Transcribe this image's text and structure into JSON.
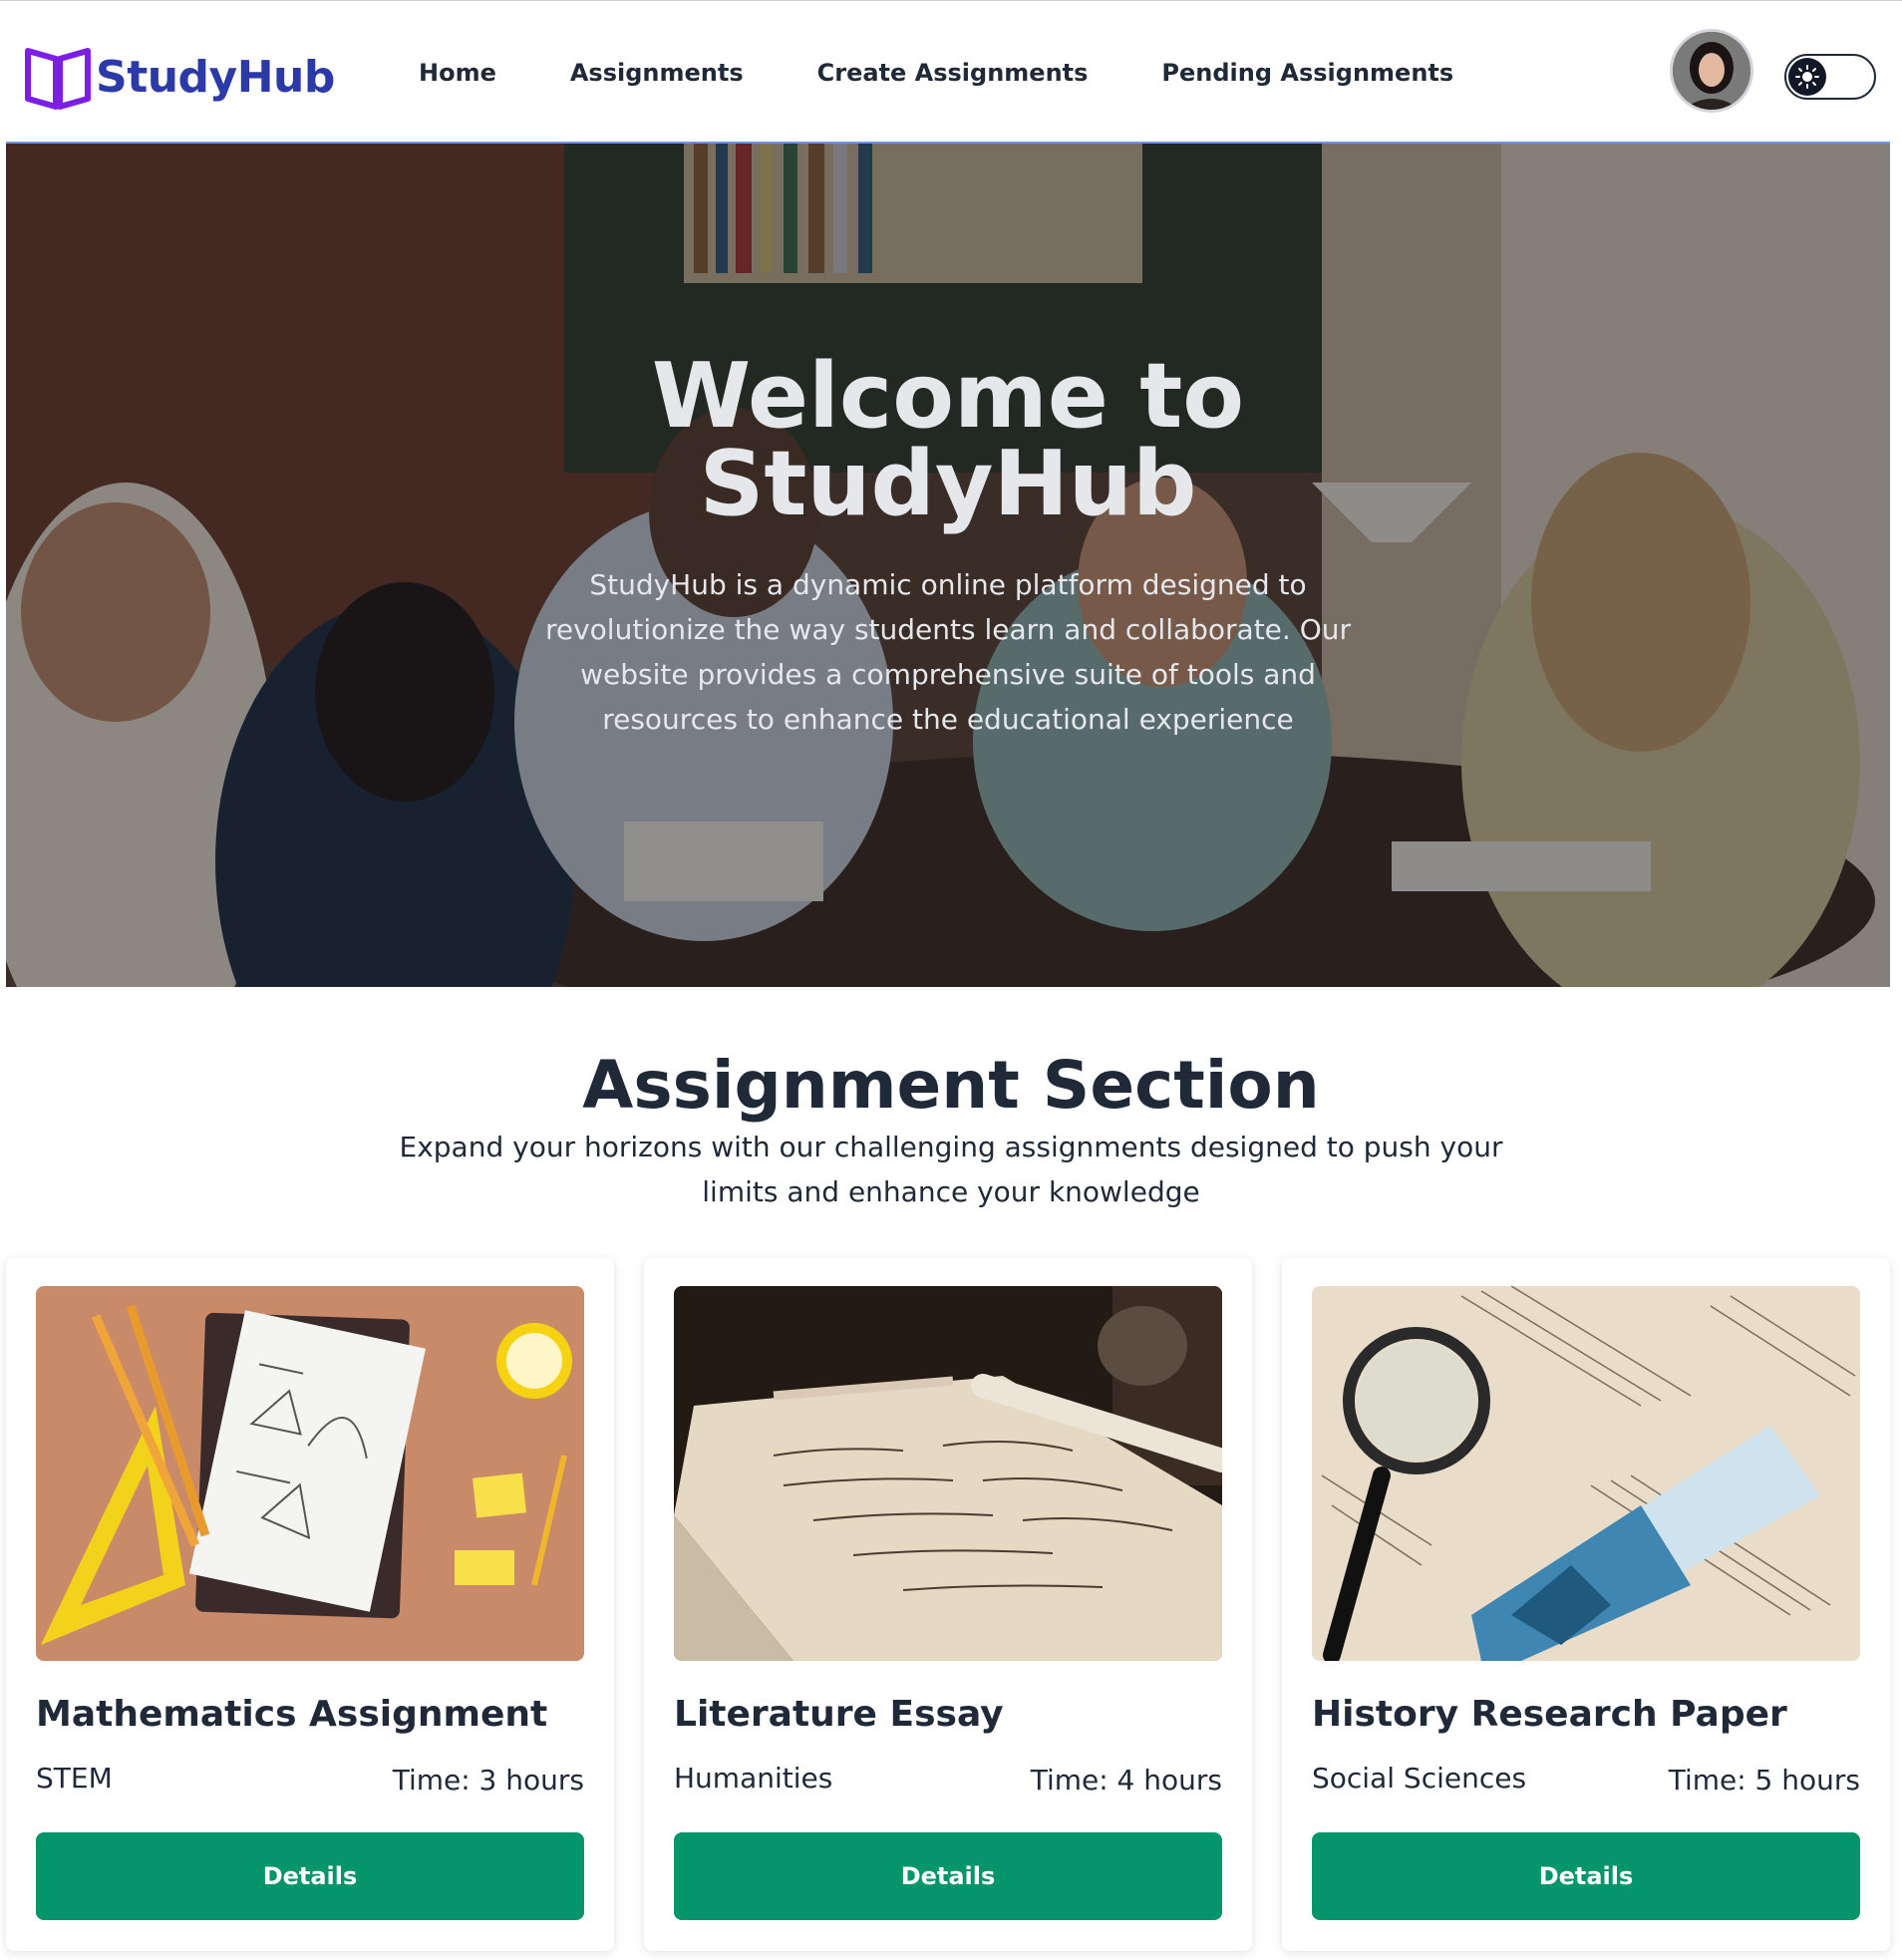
{
  "brand": {
    "name": "StudyHub",
    "accent": "#7c1ee6",
    "text_color": "#2b3aa6"
  },
  "nav": {
    "links": [
      "Home",
      "Assignments",
      "Create Assignments",
      "Pending Assignments"
    ]
  },
  "user": {
    "avatar_icon": "user-avatar"
  },
  "theme_toggle": {
    "icon": "sun-icon",
    "state": "light"
  },
  "hero": {
    "title_line1": "Welcome to",
    "title_line2": "StudyHub",
    "description": "StudyHub is a dynamic online platform designed to revolutionize the way students learn and collaborate. Our website provides a comprehensive suite of tools and resources to enhance the educational experience"
  },
  "section": {
    "title": "Assignment Section",
    "subtitle": "Expand your horizons with our challenging assignments designed to push your limits and enhance your knowledge"
  },
  "assignments": [
    {
      "title": "Mathematics Assignment",
      "category": "STEM",
      "time": "Time: 3 hours",
      "button": "Details"
    },
    {
      "title": "Literature Essay",
      "category": "Humanities",
      "time": "Time: 4 hours",
      "button": "Details"
    },
    {
      "title": "History Research Paper",
      "category": "Social Sciences",
      "time": "Time: 5 hours",
      "button": "Details"
    }
  ],
  "colors": {
    "button": "#05956a",
    "nav_underline": "#6b95e8"
  }
}
